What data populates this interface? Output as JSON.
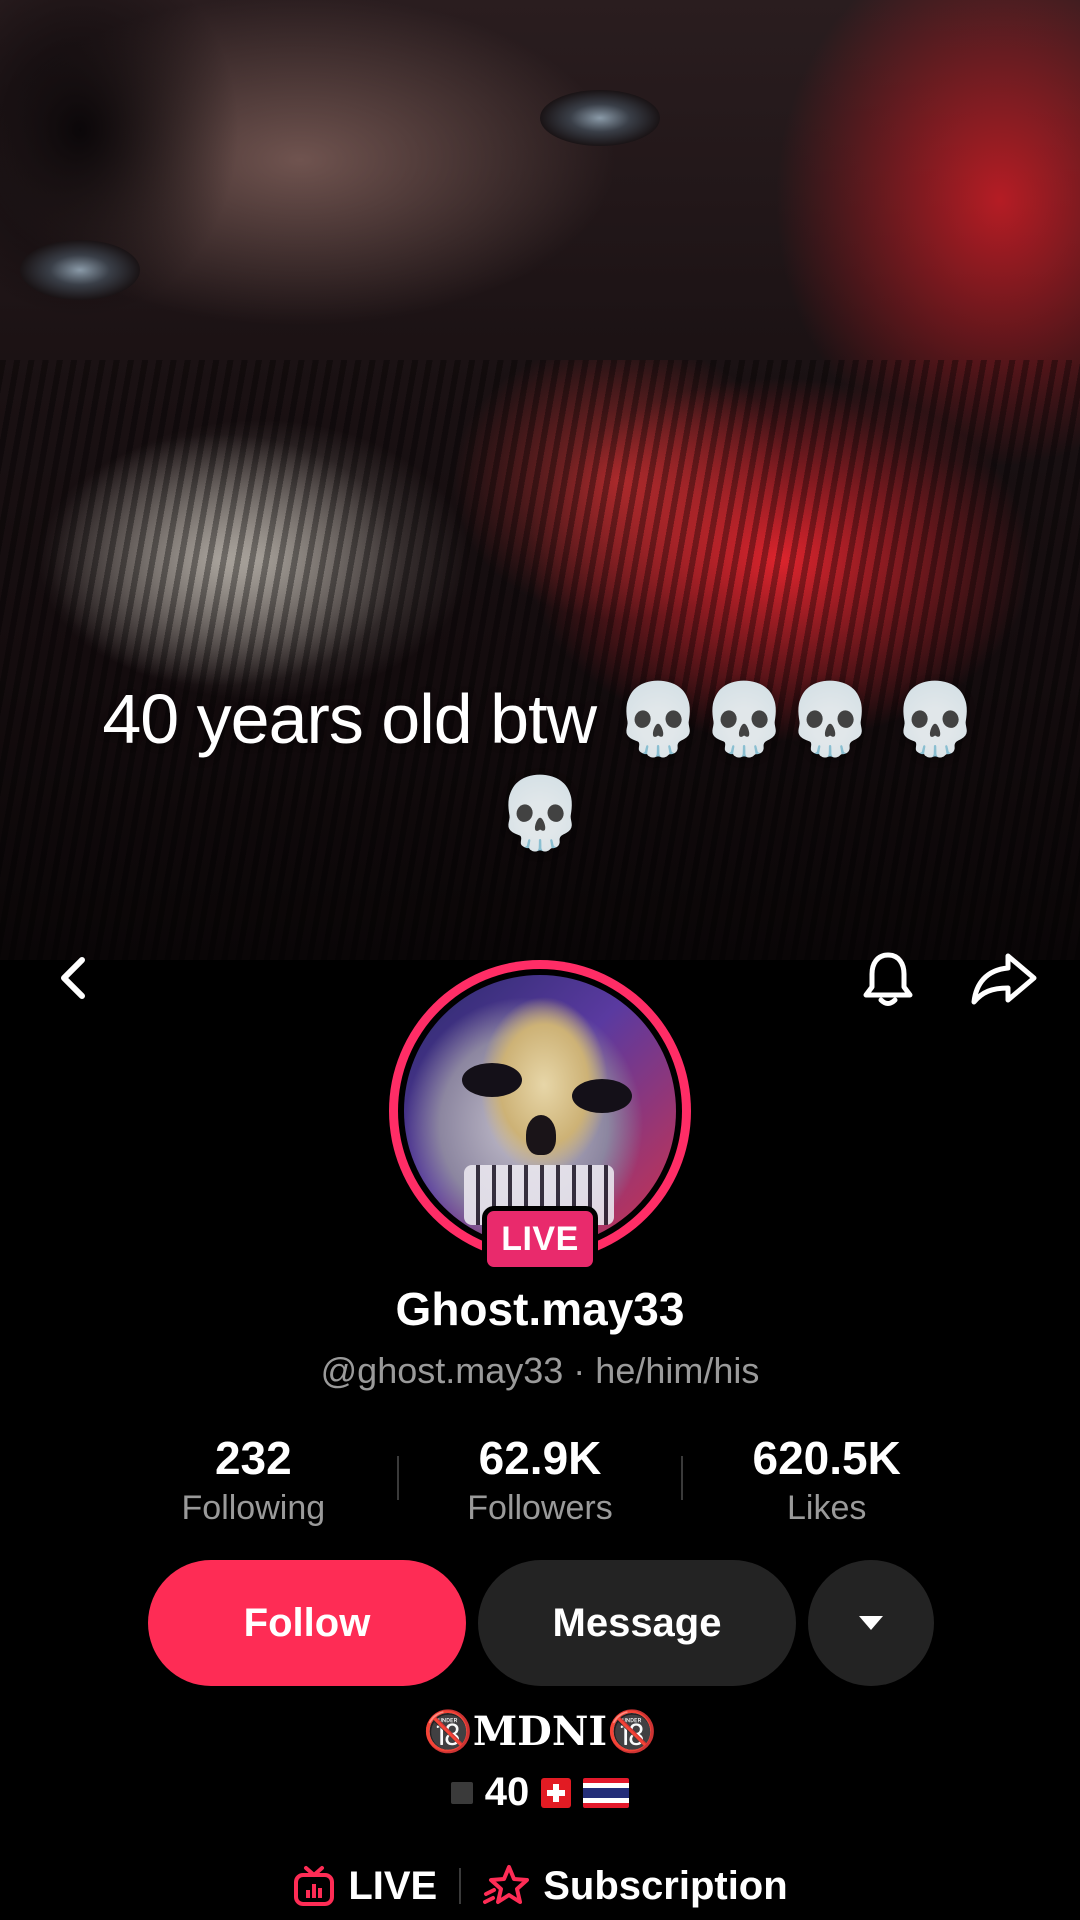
{
  "cover": {
    "caption": "40 years old btw 💀💀💀 💀💀"
  },
  "nav": {
    "back_icon": "chevron-left-icon",
    "bell_icon": "bell-icon",
    "share_icon": "share-arrow-icon"
  },
  "profile": {
    "live_badge": "LIVE",
    "display_name": "Ghost.may33",
    "handle": "@ghost.may33",
    "separator": " · ",
    "pronouns": "he/him/his"
  },
  "stats": [
    {
      "value": "232",
      "label": "Following"
    },
    {
      "value": "62.9K",
      "label": "Followers"
    },
    {
      "value": "620.5K",
      "label": "Likes"
    }
  ],
  "actions": {
    "follow_label": "Follow",
    "message_label": "Message",
    "more_icon": "caret-down-icon"
  },
  "bio": {
    "line1": "🔞MDNI🔞",
    "line2_text": "40"
  },
  "links": {
    "live_label": "LIVE",
    "subscription_label": "Subscription"
  },
  "colors": {
    "accent_pink": "#fe2c55",
    "live_pink": "#e92a6c",
    "button_dark": "#232323",
    "muted_text": "#9a9a9a"
  }
}
